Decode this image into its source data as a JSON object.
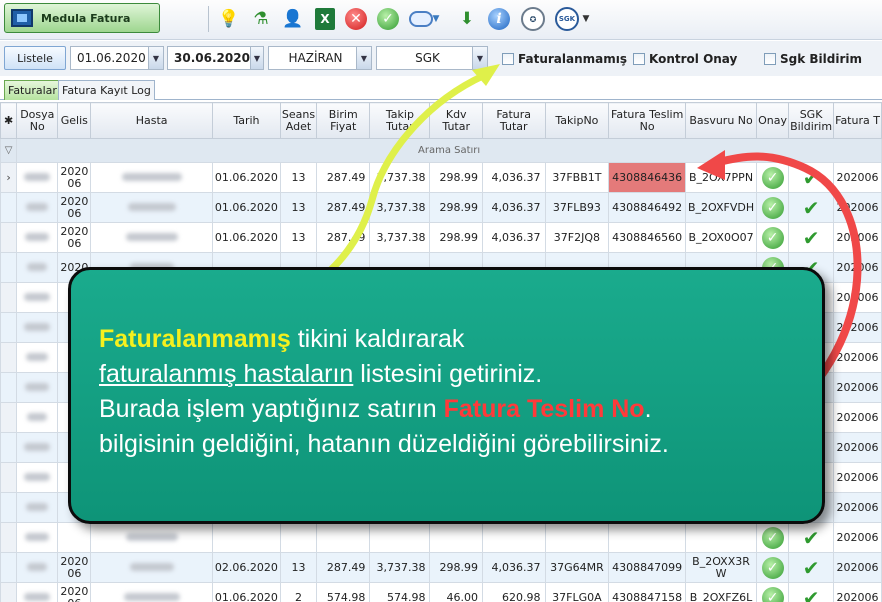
{
  "toolbar": {
    "app_title": "Medula Fatura",
    "excel_label": "X",
    "cancel_label": "✕",
    "ok_label": "✓",
    "info_label": "i",
    "sgk_label": "SGK"
  },
  "filters": {
    "listele_label": "Listele",
    "date_start": "01.06.2020",
    "date_end": "30.06.2020",
    "month": "HAZİRAN",
    "institution": "SGK",
    "chk_faturalanmamis": "Faturalanmamış",
    "chk_kontrol_onay": "Kontrol Onay",
    "chk_sgk_bildirim": "Sgk Bildirim"
  },
  "tabs": [
    "Faturalar",
    "Fatura Kayıt Log"
  ],
  "grid": {
    "headers": [
      "Dosya No",
      "Gelis",
      "Hasta",
      "Tarih",
      "Seans Adet",
      "Birim Fiyat",
      "Takip Tutar",
      "Kdv Tutar",
      "Fatura Tutar",
      "TakipNo",
      "Fatura Teslim No",
      "Basvuru No",
      "Onay",
      "SGK Bildirim",
      "Fatura T"
    ],
    "search_row_label": "Arama Satırı",
    "rows": [
      {
        "gelis": "2020 06",
        "tarih": "01.06.2020",
        "seans": "13",
        "birim": "287.49",
        "takip": "3,737.38",
        "kdv": "298.99",
        "fatura": "4,036.37",
        "takipno": "37FBB1T",
        "teslim": "4308846436",
        "basvuru": "B_2OX7PPN",
        "ft": "202006"
      },
      {
        "gelis": "2020 06",
        "tarih": "01.06.2020",
        "seans": "13",
        "birim": "287.49",
        "takip": "3,737.38",
        "kdv": "298.99",
        "fatura": "4,036.37",
        "takipno": "37FLB93",
        "teslim": "4308846492",
        "basvuru": "B_2OXFVDH",
        "ft": "202006"
      },
      {
        "gelis": "2020 06",
        "tarih": "01.06.2020",
        "seans": "13",
        "birim": "287.49",
        "takip": "3,737.38",
        "kdv": "298.99",
        "fatura": "4,036.37",
        "takipno": "37F2JQ8",
        "teslim": "4308846560",
        "basvuru": "B_2OX0O07",
        "ft": "202006"
      },
      {
        "gelis": "2020",
        "ft": "202006"
      },
      {
        "gelis": "",
        "ft": "202006"
      },
      {
        "gelis": "",
        "ft": "202006"
      },
      {
        "gelis": "",
        "ft": "202006"
      },
      {
        "gelis": "",
        "ft": "202006"
      },
      {
        "gelis": "",
        "ft": "202006"
      },
      {
        "gelis": "",
        "ft": "202006"
      },
      {
        "gelis": "",
        "ft": "202006"
      },
      {
        "gelis": "",
        "ft": "202006"
      },
      {
        "gelis": "",
        "ft": "202006"
      },
      {
        "gelis": "2020 06",
        "tarih": "02.06.2020",
        "seans": "13",
        "birim": "287.49",
        "takip": "3,737.38",
        "kdv": "298.99",
        "fatura": "4,036.37",
        "takipno": "37G64MR",
        "teslim": "4308847099",
        "basvuru": "B_2OXX3R W",
        "ft": "202006"
      },
      {
        "gelis": "2020 06",
        "tarih": "01.06.2020",
        "seans": "2",
        "birim": "574.98",
        "takip": "574.98",
        "kdv": "46.00",
        "fatura": "620.98",
        "takipno": "37FLG0A",
        "teslim": "4308847158",
        "basvuru": "B_2OXFZ6L",
        "ft": "202006"
      }
    ]
  },
  "callout": {
    "line1_highlight": "Faturalanmamış",
    "line1_rest": " tikini kaldırarak",
    "line2_underlined": "faturalanmış hastaların",
    "line2_rest": " listesini getiriniz.",
    "line3_start": "Burada işlem yaptığınız satırın ",
    "line3_highlight": "Fatura Teslim No",
    "line3_end": ".",
    "line4": "bilgisinin geldiğini, hatanın düzeldiğini görebilirsiniz."
  },
  "colors": {
    "callout_bg": "#13a083",
    "highlight_yellow": "#f5f01e",
    "highlight_red": "#ff3a3a",
    "arrow_yellow": "#dff04a",
    "arrow_red": "#f04848",
    "teslim_cell": "#e47a7a"
  }
}
